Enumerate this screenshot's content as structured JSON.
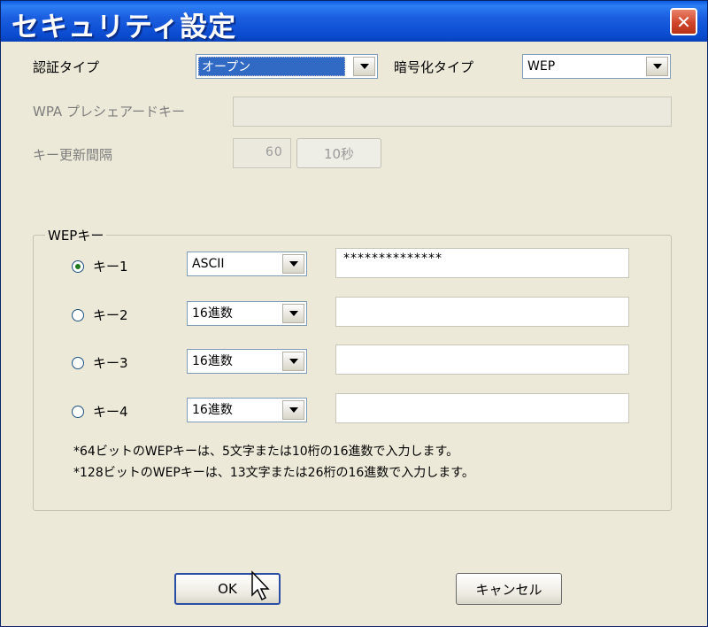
{
  "window": {
    "title": "セキュリティ設定",
    "close_label": "✕"
  },
  "auth": {
    "label": "認証タイプ",
    "value": "オープン"
  },
  "encryption": {
    "label": "暗号化タイプ",
    "value": "WEP"
  },
  "wpa": {
    "label": "WPA プレシェアードキー",
    "value": ""
  },
  "interval": {
    "label": "キー更新間隔",
    "value": "60",
    "unit_button": "10秒"
  },
  "wep": {
    "group_label": "WEPキー",
    "keys": [
      {
        "label": "キー1",
        "format": "ASCII",
        "value": "**************",
        "selected": true
      },
      {
        "label": "キー2",
        "format": "16進数",
        "value": "",
        "selected": false
      },
      {
        "label": "キー3",
        "format": "16進数",
        "value": "",
        "selected": false
      },
      {
        "label": "キー4",
        "format": "16進数",
        "value": "",
        "selected": false
      }
    ],
    "notes": [
      "*64ビットのWEPキーは、5文字または10桁の16進数で入力します。",
      "*128ビットのWEPキーは、13文字または26桁の16進数で入力します。"
    ]
  },
  "buttons": {
    "ok": "OK",
    "cancel": "キャンセル"
  }
}
